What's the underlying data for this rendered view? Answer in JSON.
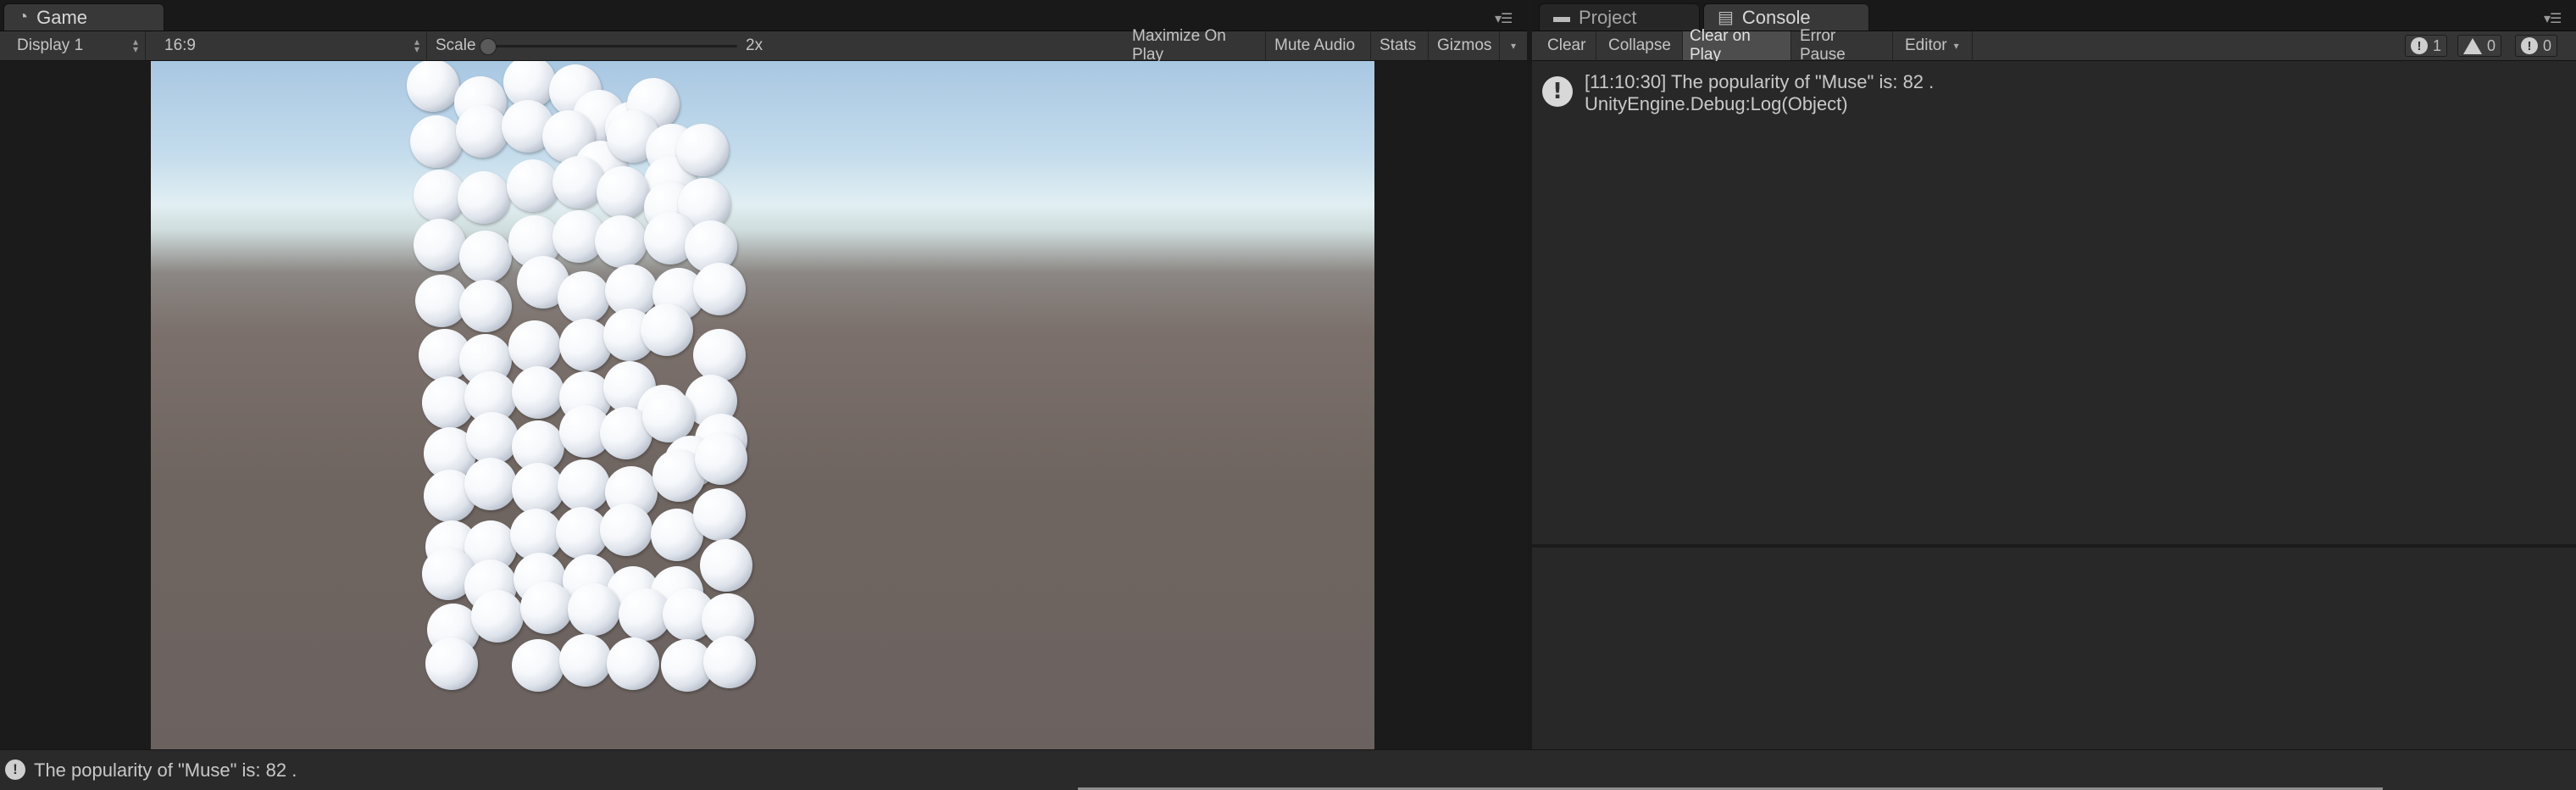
{
  "game_panel": {
    "tab_label": "Game",
    "tab_icon": "pacman-icon",
    "display_select": "Display 1",
    "aspect_select": "16:9",
    "scale_label": "Scale",
    "scale_value": "2x",
    "maximize_on_play": "Maximize On Play",
    "mute_audio": "Mute Audio",
    "stats": "Stats",
    "gizmos": "Gizmos"
  },
  "console_panel": {
    "tabs": [
      {
        "label": "Project",
        "icon": "folder-icon"
      },
      {
        "label": "Console",
        "icon": "console-icon"
      }
    ],
    "toolbar": {
      "clear": "Clear",
      "collapse": "Collapse",
      "clear_on_play": "Clear on Play",
      "error_pause": "Error Pause",
      "editor": "Editor"
    },
    "counts": {
      "info": "1",
      "warning": "0",
      "error": "0"
    },
    "log_entries": [
      {
        "line1": "[11:10:30] The popularity of \"Muse\" is: 82 .",
        "line2": "UnityEngine.Debug:Log(Object)"
      }
    ]
  },
  "status_bar": {
    "message": "The popularity of \"Muse\" is: 82 ."
  }
}
